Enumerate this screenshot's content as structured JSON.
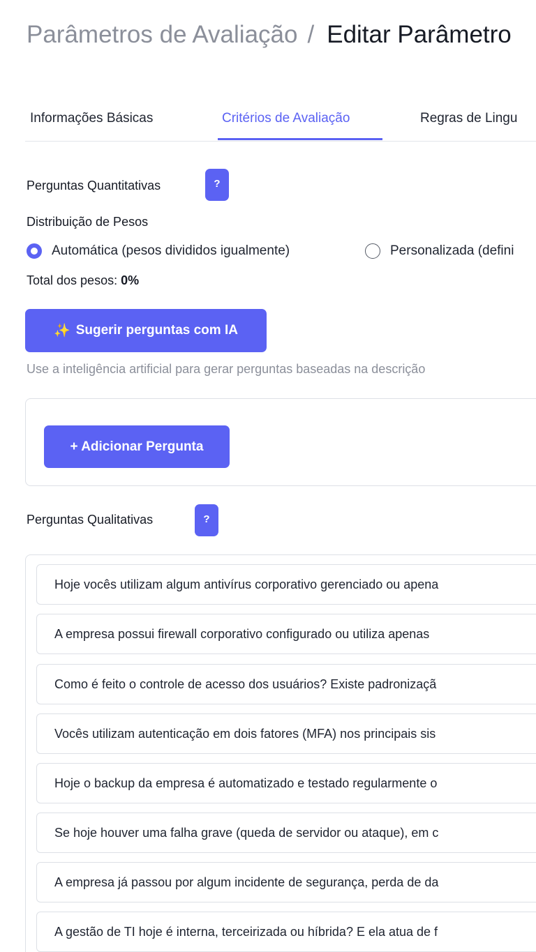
{
  "breadcrumb": {
    "parent": "Parâmetros de Avaliação",
    "separator": "/",
    "current": "Editar Parâmetro"
  },
  "tabs": [
    {
      "label": "Informações Básicas",
      "active": false
    },
    {
      "label": "Critérios de Avaliação",
      "active": true
    },
    {
      "label": "Regras de Lingu",
      "active": false
    }
  ],
  "quantitative": {
    "title": "Perguntas Quantitativas",
    "help": "?",
    "weights_label": "Distribuição de Pesos",
    "radio_options": [
      {
        "label": "Automática (pesos divididos igualmente)",
        "checked": true
      },
      {
        "label": "Personalizada (defini",
        "checked": false
      }
    ],
    "total_label": "Total dos pesos:",
    "total_value": "0%",
    "suggest_button": "Sugerir perguntas com IA",
    "suggest_icon": "sparkles-icon",
    "hint": "Use a inteligência artificial para gerar perguntas baseadas na descrição",
    "add_button": "+ Adicionar Pergunta"
  },
  "qualitative": {
    "title": "Perguntas Qualitativas",
    "help": "?",
    "questions": [
      "Hoje vocês utilizam algum antivírus corporativo gerenciado ou apena",
      "A empresa possui firewall corporativo configurado ou utiliza apenas",
      "Como é feito o controle de acesso dos usuários? Existe padronizaçã",
      "Vocês utilizam autenticação em dois fatores (MFA) nos principais sis",
      "Hoje o backup da empresa é automatizado e testado regularmente o",
      "Se hoje houver uma falha grave (queda de servidor ou ataque), em c",
      "A empresa já passou por algum incidente de segurança, perda de da",
      "A gestão de TI hoje é interna, terceirizada ou híbrida? E ela atua de f"
    ]
  },
  "colors": {
    "accent": "#5b62f3",
    "muted_text": "#8b8f9a",
    "border": "#dde0e6"
  }
}
